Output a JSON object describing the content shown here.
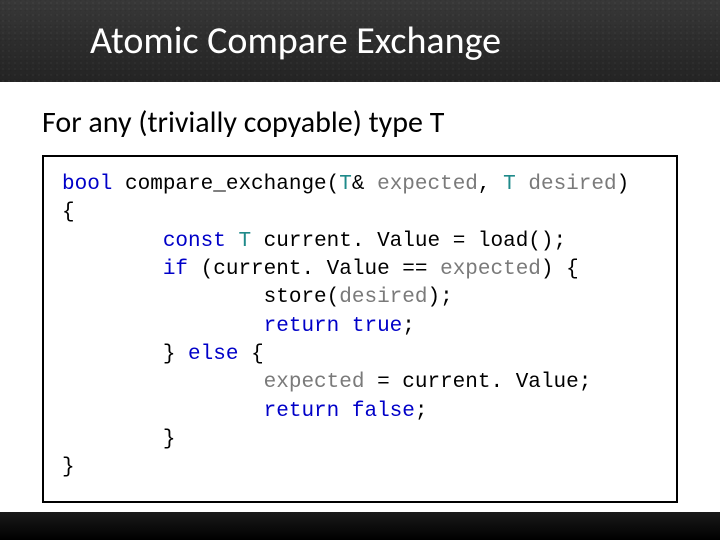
{
  "title": "Atomic Compare Exchange",
  "subtitle": "For any (trivially copyable) type T",
  "code": {
    "l1_kw": "bool",
    "l1_fn": " compare_exchange(",
    "l1_t1": "T",
    "l1_amp": "& ",
    "l1_exp": "expected",
    "l1_comma": ", ",
    "l1_t2": "T",
    "l1_sp": " ",
    "l1_des": "desired",
    "l1_close": ")",
    "l2": "{",
    "l3_pad": "        ",
    "l3_const": "const",
    "l3_sp": " ",
    "l3_t": "T",
    "l3_rest": " current. Value = load();",
    "l4_pad": "        ",
    "l4_if": "if",
    "l4_open": " (current. Value == ",
    "l4_exp": "expected",
    "l4_close": ") {",
    "l5_pad": "                ",
    "l5_rest": "store(",
    "l5_des": "desired",
    "l5_close": ");",
    "l6_pad": "                ",
    "l6_ret": "return",
    "l6_sp": " ",
    "l6_true": "true",
    "l6_semi": ";",
    "l7_pad": "        ",
    "l7_rest": "} ",
    "l7_else": "else",
    "l7_brace": " {",
    "l8_pad": "                ",
    "l8_exp": "expected",
    "l8_rest": " = current. Value;",
    "l9_pad": "                ",
    "l9_ret": "return",
    "l9_sp": " ",
    "l9_false": "false",
    "l9_semi": ";",
    "l10_pad": "        ",
    "l10_brace": "}",
    "l11": "}"
  }
}
